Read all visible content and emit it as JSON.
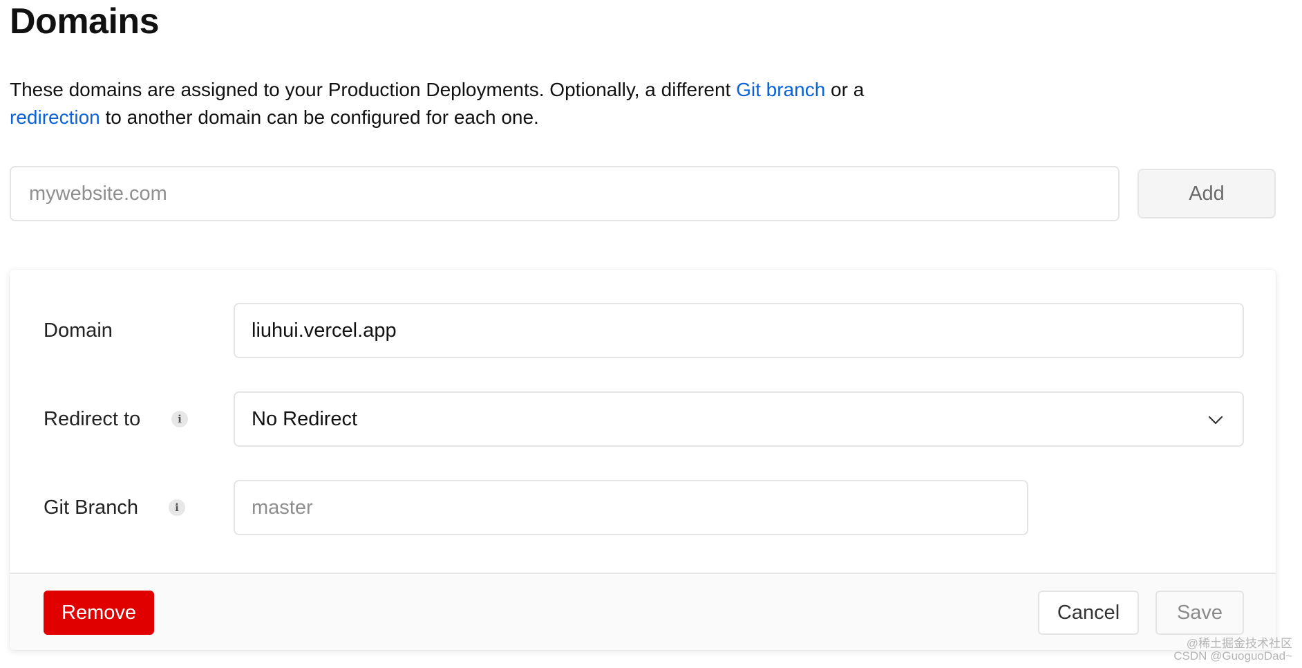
{
  "page": {
    "title": "Domains",
    "description": {
      "part1": "These domains are assigned to your Production Deployments. Optionally, a different ",
      "link1": "Git branch",
      "part2": " or a ",
      "link2": "redirection",
      "part3": " to another domain can be configured for each one."
    }
  },
  "add_domain": {
    "placeholder": "mywebsite.com",
    "value": "",
    "add_label": "Add"
  },
  "domain_card": {
    "domain_label": "Domain",
    "domain_value": "liuhui.vercel.app",
    "redirect_label": "Redirect to",
    "redirect_value": "No Redirect",
    "git_branch_label": "Git Branch",
    "git_branch_placeholder": "master",
    "git_branch_value": "",
    "info_icon_glyph": "i",
    "remove_label": "Remove",
    "cancel_label": "Cancel",
    "save_label": "Save"
  },
  "icons": {
    "info": "info-icon",
    "chevron": "chevron-down-icon"
  },
  "colors": {
    "link": "#0b62d6",
    "danger": "#e00000"
  },
  "watermark": {
    "line1": "@稀土掘金技术社区",
    "line2": "CSDN @GuoguoDad~"
  }
}
